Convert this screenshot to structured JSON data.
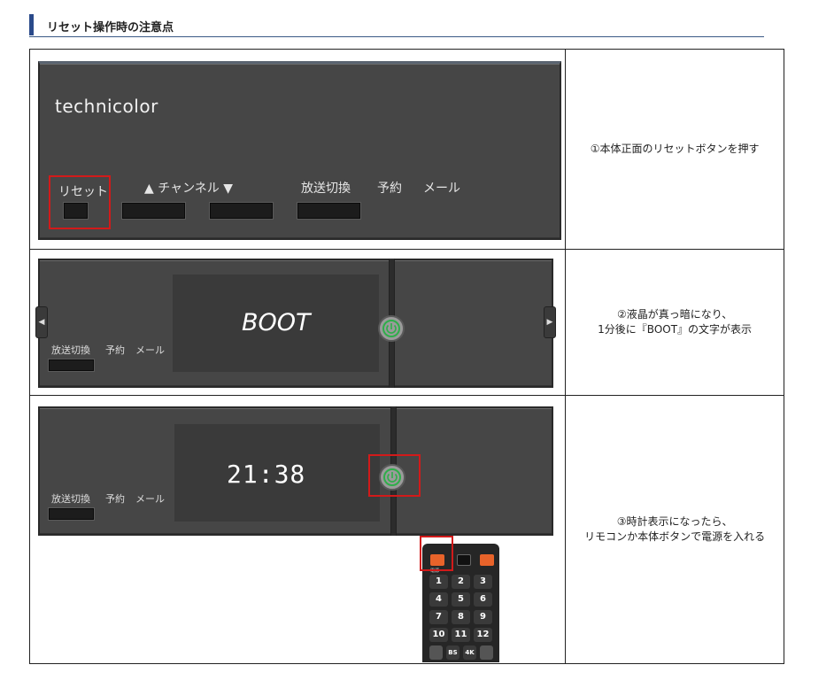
{
  "heading": {
    "title": "リセット操作時の注意点",
    "accent_color": "#2a4a8a"
  },
  "rows": [
    {
      "description_lines": [
        "①本体正面のリセットボタンを押す"
      ],
      "panel": {
        "brand": "technicolor",
        "reset_label": "リセット",
        "channel_label": "▲ チャンネル ▼",
        "broadcast_label": "放送切換",
        "reservation_label": "予約",
        "mail_label": "メール"
      }
    },
    {
      "description_lines": [
        "②液晶が真っ暗になり、",
        "1分後に『BOOT』の文字が表示"
      ],
      "panel": {
        "display_text": "BOOT",
        "broadcast_label": "放送切換",
        "reservation_label": "予約",
        "mail_label": "メール"
      }
    },
    {
      "description_lines": [
        "③時計表示になったら、",
        "リモコンか本体ボタンで電源を入れる"
      ],
      "panel": {
        "display_text": "21:38",
        "broadcast_label": "放送切換",
        "reservation_label": "予約",
        "mail_label": "メール"
      },
      "remote": {
        "power_label": "電源",
        "keys": [
          "1",
          "2",
          "3",
          "4",
          "5",
          "6",
          "7",
          "8",
          "9",
          "10",
          "11",
          "12"
        ],
        "bottom_keys": [
          "BS",
          "4K"
        ]
      }
    }
  ],
  "colors": {
    "highlight": "#d21a1a",
    "power_ring": "#2fae4a",
    "panel": "#464646"
  }
}
